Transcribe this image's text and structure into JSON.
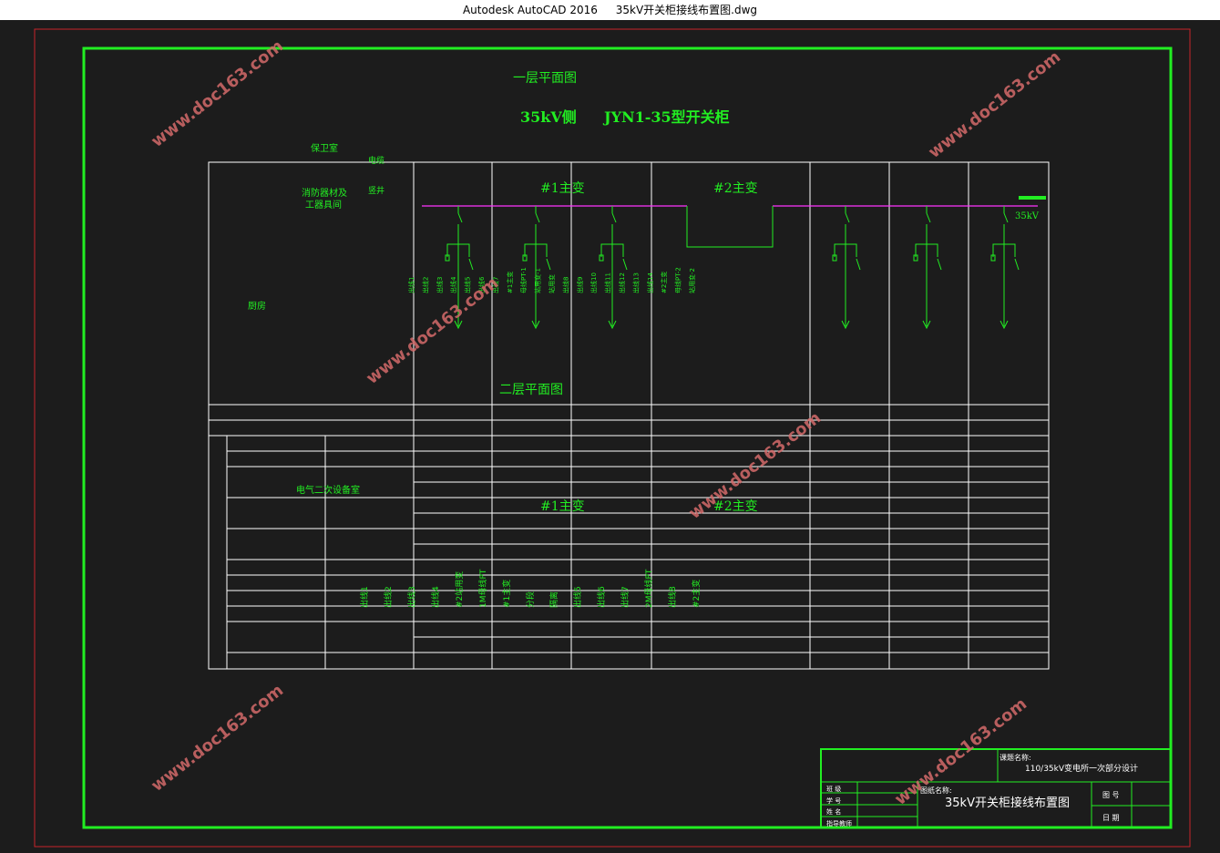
{
  "window": {
    "app_title": "Autodesk AutoCAD 2016",
    "file_name": "35kV开关柜接线布置图.dwg"
  },
  "drawing": {
    "title_floor1": "一层平面图",
    "title_floor2": "二层平面图",
    "subtitle_left": "35kV侧",
    "subtitle_right": "JYN1-35型开关柜",
    "rooms": {
      "guard": "保卫室",
      "cable": "电缆",
      "fire": "消防器材及",
      "tools": "工器具间",
      "shaft": "竖井",
      "kitchen": "厨房",
      "secondary": "电气二次设备室"
    },
    "transformer1": "#1主变",
    "transformer2": "#2主变",
    "bus_voltage": "35kV",
    "bus_tag": "▬▬▬",
    "floor1_labels": [
      "出线1",
      "出线2",
      "出线3",
      "出线4",
      "出线5",
      "出线6",
      "出线7",
      "#1主变",
      "母线PT-1",
      "站用变-1",
      "站用变",
      "出线8",
      "出线9",
      "出线10",
      "出线11",
      "出线12",
      "出线13",
      "出线14",
      "#2主变",
      "母线PT-2",
      "站用变-2"
    ],
    "floor2_labels": [
      "出线1",
      "出线2",
      "出线3",
      "出线4",
      "#2站用变",
      "1M母线PT",
      "#1主变",
      "分段",
      "隔离",
      "出线5",
      "出线6",
      "出线7",
      "2M母线PT",
      "出线8",
      "#2主变"
    ]
  },
  "title_block": {
    "project_label": "课题名称:",
    "project_name": "110/35kV变电所一次部分设计",
    "drawing_label": "图纸名称:",
    "drawing_name": "35kV开关柜接线布置图",
    "rows": [
      "班 级",
      "学 号",
      "姓 名",
      "指导教师"
    ],
    "fig_no": "图 号",
    "date": "日 期"
  },
  "watermark": "www.doc163.com"
}
